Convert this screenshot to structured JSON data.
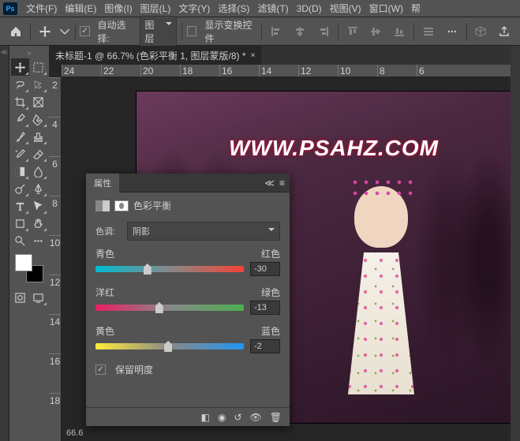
{
  "menu": {
    "file": "文件(F)",
    "edit": "编辑(E)",
    "image": "图像(I)",
    "layer": "图层(L)",
    "type": "文字(Y)",
    "select": "选择(S)",
    "filter": "滤镜(T)",
    "threeD": "3D(D)",
    "view": "视图(V)",
    "window": "窗口(W)",
    "help": "帮"
  },
  "optbar": {
    "autoSelect": "自动选择:",
    "autoSelectTarget": "图层",
    "showTransform": "显示变换控件"
  },
  "document": {
    "tab": "未标题-1 @ 66.7% (色彩平衡 1, 图层蒙版/8) *",
    "zoom": "66.6"
  },
  "rulerH": [
    "24",
    "22",
    "20",
    "18",
    "16",
    "14",
    "12",
    "10",
    "8",
    "6"
  ],
  "rulerV": [
    "2",
    "4",
    "6",
    "8",
    "10",
    "12",
    "14",
    "16",
    "18"
  ],
  "watermark": "WWW.PSAHZ.COM",
  "panel": {
    "title": "属性",
    "adjName": "色彩平衡",
    "toneLabel": "色调:",
    "toneValue": "阴影",
    "s1": {
      "left": "青色",
      "right": "红色",
      "value": "-30",
      "pos": 35
    },
    "s2": {
      "left": "洋红",
      "right": "绿色",
      "value": "-13",
      "pos": 43
    },
    "s3": {
      "left": "黄色",
      "right": "蓝色",
      "value": "-2",
      "pos": 49
    },
    "preserve": "保留明度"
  }
}
